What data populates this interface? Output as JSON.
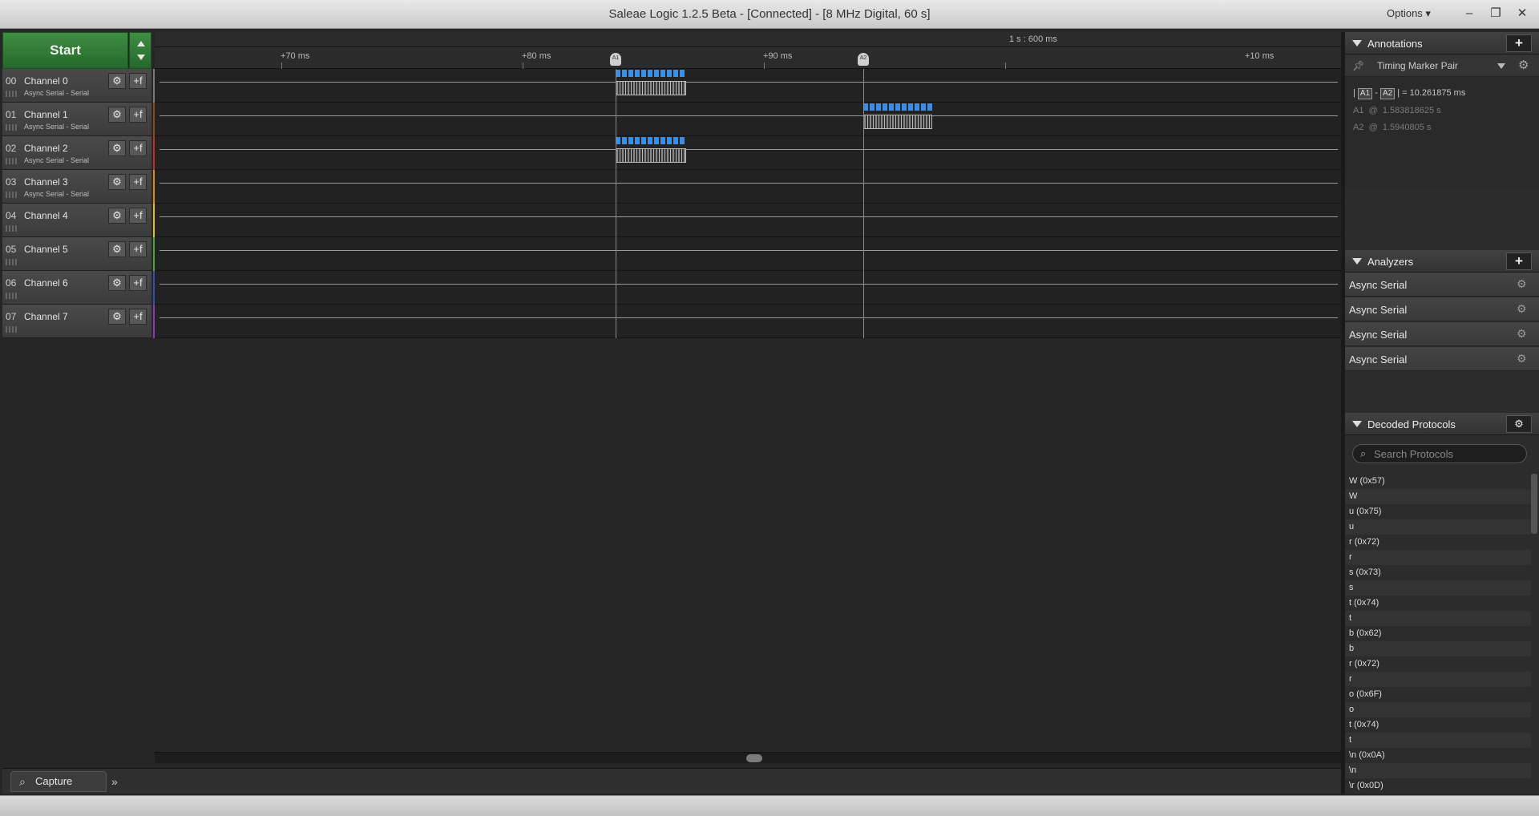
{
  "window": {
    "title": "Saleae Logic 1.2.5 Beta - [Connected] - [8 MHz Digital, 60 s]",
    "options_label": "Options"
  },
  "capture": {
    "start_label": "Start"
  },
  "channels": [
    {
      "num": "00",
      "name": "Channel 0",
      "sub": "Async Serial - Serial",
      "color": "#7a7a7a"
    },
    {
      "num": "01",
      "name": "Channel 1",
      "sub": "Async Serial - Serial",
      "color": "#8a4a1c"
    },
    {
      "num": "02",
      "name": "Channel 2",
      "sub": "Async Serial - Serial",
      "color": "#c0302a"
    },
    {
      "num": "03",
      "name": "Channel 3",
      "sub": "Async Serial - Serial",
      "color": "#e08a1e"
    },
    {
      "num": "04",
      "name": "Channel 4",
      "sub": "",
      "color": "#e0c21e"
    },
    {
      "num": "05",
      "name": "Channel 5",
      "sub": "",
      "color": "#4aa83a"
    },
    {
      "num": "06",
      "name": "Channel 6",
      "sub": "",
      "color": "#2f4fbf"
    },
    {
      "num": "07",
      "name": "Channel 7",
      "sub": "",
      "color": "#8a3ab8"
    }
  ],
  "timeline": {
    "absolute_label": "1 s : 600 ms",
    "ticks": [
      "+70 ms",
      "+80 ms",
      "+90 ms",
      "+10 ms"
    ],
    "marker_labels": [
      "A1",
      "A2"
    ]
  },
  "bottom": {
    "capture_tab": "Capture",
    "more_icon": "double-chevron-right-icon"
  },
  "annotations": {
    "title": "Annotations",
    "marker_pair": "Timing Marker Pair",
    "measure_a": "A1",
    "measure_b": "A2",
    "measure_value": "10.261875 ms",
    "a1_time": "1.583818625 s",
    "a2_time": "1.5940805 s"
  },
  "analyzers": {
    "title": "Analyzers",
    "items": [
      "Async Serial",
      "Async Serial",
      "Async Serial",
      "Async Serial"
    ]
  },
  "decoded": {
    "title": "Decoded Protocols",
    "search_placeholder": "Search Protocols",
    "rows": [
      "W (0x57)",
      "W",
      "u (0x75)",
      "u",
      "r (0x72)",
      "r",
      "s (0x73)",
      "s",
      "t (0x74)",
      "t",
      "b (0x62)",
      "b",
      "r (0x72)",
      "r",
      "o (0x6F)",
      "o",
      "t (0x74)",
      "t",
      "\\n (0x0A)",
      "\\n",
      "\\r (0x0D)"
    ]
  }
}
